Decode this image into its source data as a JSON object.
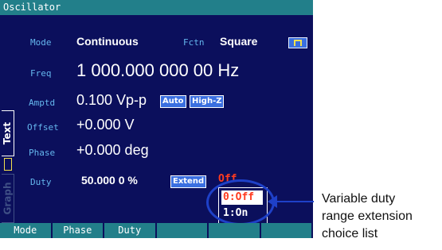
{
  "window": {
    "title": "Oscillator"
  },
  "side_tabs": {
    "text": "Text",
    "graph": "Graph"
  },
  "fields": {
    "mode": {
      "label": "Mode",
      "value": "Continuous"
    },
    "fctn": {
      "label": "Fctn",
      "value": "Square",
      "icon": "square-wave-icon"
    },
    "freq": {
      "label": "Freq",
      "value": "1 000.000 000 00 Hz"
    },
    "amptd": {
      "label": "Amptd",
      "value": "0.100 Vp-p",
      "badges": [
        "Auto",
        "High-Z"
      ]
    },
    "offset": {
      "label": "Offset",
      "value": "+0.000 V"
    },
    "phase": {
      "label": "Phase",
      "value": "+0.000 deg"
    },
    "duty": {
      "label": "Duty",
      "value": "50.000 0 %",
      "extend_label": "Extend",
      "extend_value": "Off"
    }
  },
  "choice_list": {
    "options": [
      "0:Off",
      "1:On"
    ],
    "selected": "0:Off"
  },
  "softkeys": [
    "Mode",
    "Phase",
    "Duty",
    "",
    "",
    ""
  ],
  "callout": {
    "lines": [
      "Variable duty",
      "range extension",
      "choice list"
    ]
  },
  "colors": {
    "screen_bg": "#0b0f5c",
    "bar_bg": "#227f8a",
    "label": "#65b7ee",
    "accent_blue": "#3a6fe0",
    "warning_red": "#ff3b1f",
    "callout_blue": "#1e40c8"
  }
}
